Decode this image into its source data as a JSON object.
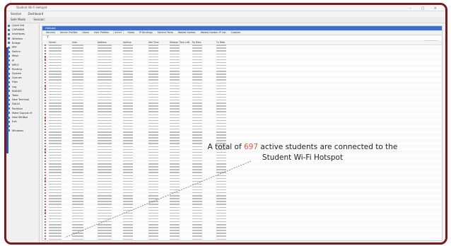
{
  "window": {
    "title": "Student Wi-Fi Hotspot",
    "controls": "–  □  ×"
  },
  "menubar": [
    "Session",
    "Dashboard"
  ],
  "toolbar": {
    "safe_mode": "Safe Mode",
    "session_label": "Session:",
    "right_text": ""
  },
  "sidebar": {
    "items": [
      "Quick Set",
      "CAPsMAN",
      "Interfaces",
      "Wireless",
      "Bridge",
      "PPP",
      "Switch",
      "Mesh",
      "IP",
      "MPLS",
      "Routing",
      "System",
      "Queues",
      "Files",
      "Log",
      "RADIUS",
      "Tools",
      "New Terminal",
      "Dot1X",
      "Partition",
      "Make Supout.rif",
      "New WinBox",
      "Exit",
      "",
      "Windows"
    ]
  },
  "panel": {
    "title": "Hotspot",
    "tabs": [
      "Servers",
      "Server Profiles",
      "Users",
      "User Profiles",
      "Active",
      "Hosts",
      "IP Bindings",
      "Service Ports",
      "Walled Garden",
      "Walled Garden IP List",
      "Cookies"
    ],
    "active_tab": "Active",
    "filter_icon": "Y",
    "columns": [
      "Server",
      "User",
      "Address",
      "Uptime",
      "Idle Time",
      "Session Time Left",
      "Rx Rate",
      "Tx Rate"
    ]
  },
  "annotation": {
    "prefix": "A total of",
    "count": "697",
    "suffix": "active students are connected to the",
    "line2": "Student Wi-Fi Hotspot",
    "count_color": "#e0563a"
  },
  "colors": {
    "frame": "#7a1a1a",
    "panel_title": "#3a6fd0",
    "sidebar_accent": "#2c56b4"
  }
}
